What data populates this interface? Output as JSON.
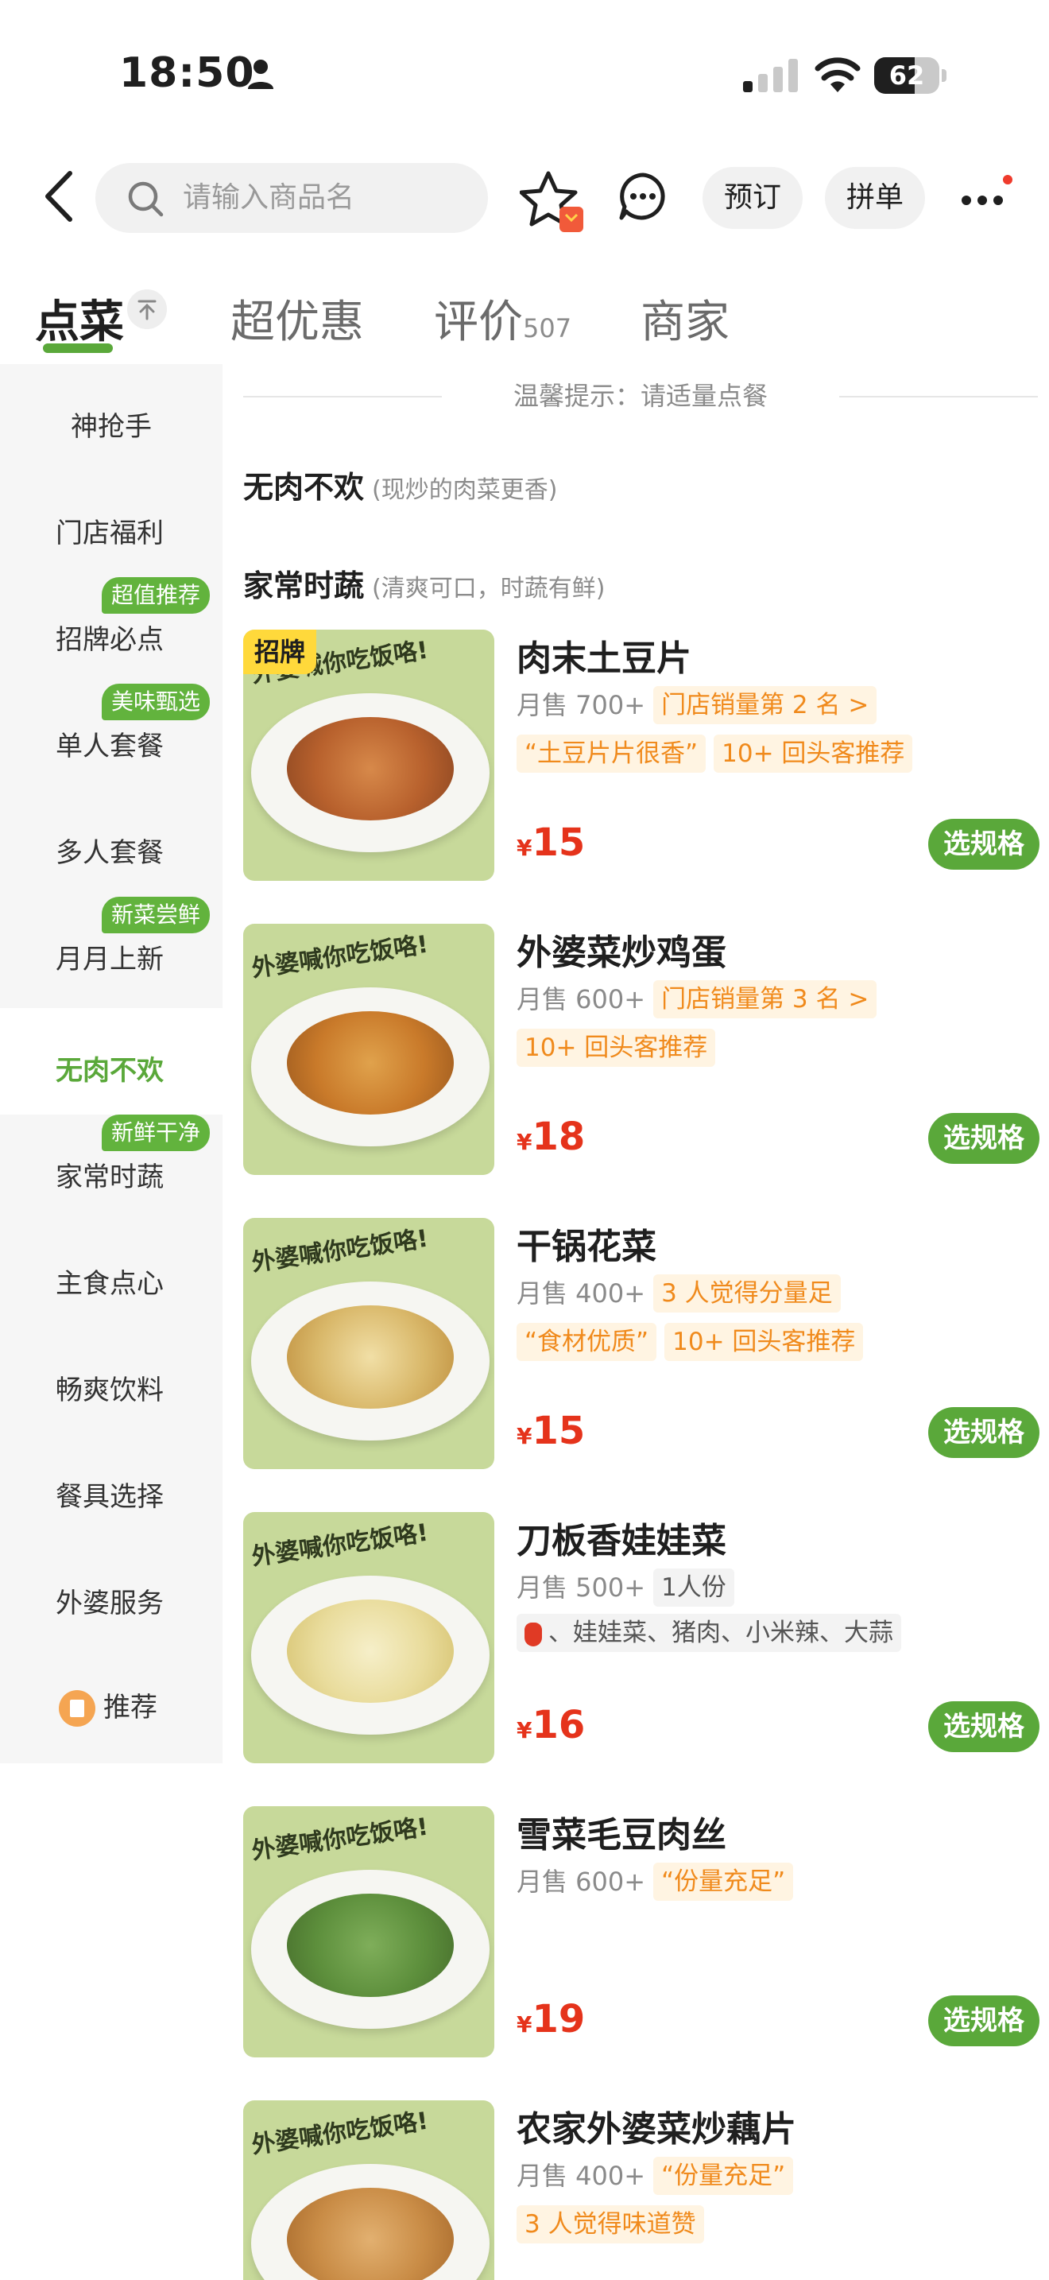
{
  "status_bar": {
    "time": "18:50",
    "battery": "62"
  },
  "search": {
    "placeholder": "请输入商品名"
  },
  "header": {
    "reserve": "预订",
    "group": "拼单"
  },
  "tabs": [
    {
      "label": "点菜"
    },
    {
      "label": "超优惠"
    },
    {
      "label": "评价",
      "count": "507"
    },
    {
      "label": "商家"
    }
  ],
  "sidebar": {
    "items": [
      {
        "label": "神抢手"
      },
      {
        "label": "门店福利"
      },
      {
        "label": "招牌必点",
        "tag": "超值推荐"
      },
      {
        "label": "单人套餐",
        "tag": "美味甄选"
      },
      {
        "label": "多人套餐"
      },
      {
        "label": "月月上新",
        "tag": "新菜尝鲜"
      },
      {
        "label": "无肉不欢"
      },
      {
        "label": "家常时蔬",
        "tag": "新鲜干净"
      },
      {
        "label": "主食点心"
      },
      {
        "label": "畅爽饮料"
      },
      {
        "label": "餐具选择"
      },
      {
        "label": "外婆服务"
      },
      {
        "label": "推荐"
      }
    ]
  },
  "content": {
    "hint": "温馨提示：请适量点餐",
    "sections": [
      {
        "title": "无肉不欢",
        "note": "(现炒的肉菜更香)"
      },
      {
        "title": "家常时蔬",
        "note": "(清爽可口，时蔬有鲜)"
      }
    ],
    "image_watermark": "外婆喊你吃饭咯!",
    "select_label": "选规格",
    "currency": "¥",
    "dishes": [
      {
        "badge": "招牌",
        "name": "肉末土豆片",
        "sales": "月售 700+",
        "tags1": [
          "门店销量第 2 名 >"
        ],
        "tags2": [
          "“土豆片片很香”",
          "10+ 回头客推荐"
        ],
        "price": "15"
      },
      {
        "name": "外婆菜炒鸡蛋",
        "sales": "月售 600+",
        "tags1": [
          "门店销量第 3 名 >"
        ],
        "tags2": [
          "10+ 回头客推荐"
        ],
        "price": "18"
      },
      {
        "name": "干锅花菜",
        "sales": "月售 400+",
        "tags1": [
          "3 人觉得分量足"
        ],
        "tags2": [
          "“食材优质”",
          "10+ 回头客推荐"
        ],
        "price": "15"
      },
      {
        "name": "刀板香娃娃菜",
        "sales": "月售 500+",
        "tags1": [
          "1人份"
        ],
        "ingredients": "、娃娃菜、猪肉、小米辣、大蒜",
        "price": "16"
      },
      {
        "name": "雪菜毛豆肉丝",
        "sales": "月售 600+",
        "tags1": [
          "“份量充足”"
        ],
        "price": "19"
      },
      {
        "name": "农家外婆菜炒藕片",
        "sales": "月售 400+",
        "tags1": [
          "“份量充足”"
        ],
        "tags2": [
          "3 人觉得味道赞"
        ]
      }
    ]
  },
  "colors": {
    "brand_green": "#5aa83a",
    "price_red": "#e5331b",
    "tag_orange": "#f08a1c"
  }
}
